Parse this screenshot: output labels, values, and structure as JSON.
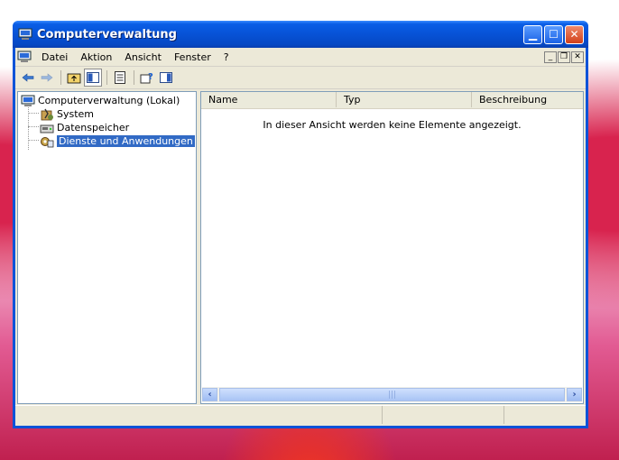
{
  "window": {
    "title": "Computerverwaltung"
  },
  "menubar": {
    "items": [
      "Datei",
      "Aktion",
      "Ansicht",
      "Fenster",
      "?"
    ]
  },
  "toolbar": {
    "icons": [
      "back-arrow-icon",
      "forward-arrow-icon",
      "up-folder-icon",
      "show-tree-icon",
      "export-list-icon",
      "help-icon",
      "action-pane-icon"
    ]
  },
  "tree": {
    "root": "Computerverwaltung (Lokal)",
    "children": [
      "System",
      "Datenspeicher",
      "Dienste und Anwendungen"
    ],
    "selected": "Dienste und Anwendungen"
  },
  "list": {
    "columns": [
      "Name",
      "Typ",
      "Beschreibung"
    ],
    "empty_message": "In dieser Ansicht werden keine Elemente angezeigt."
  },
  "colors": {
    "title_bar": "#0a53d8",
    "selection": "#316ac5",
    "face": "#ece9d8"
  }
}
